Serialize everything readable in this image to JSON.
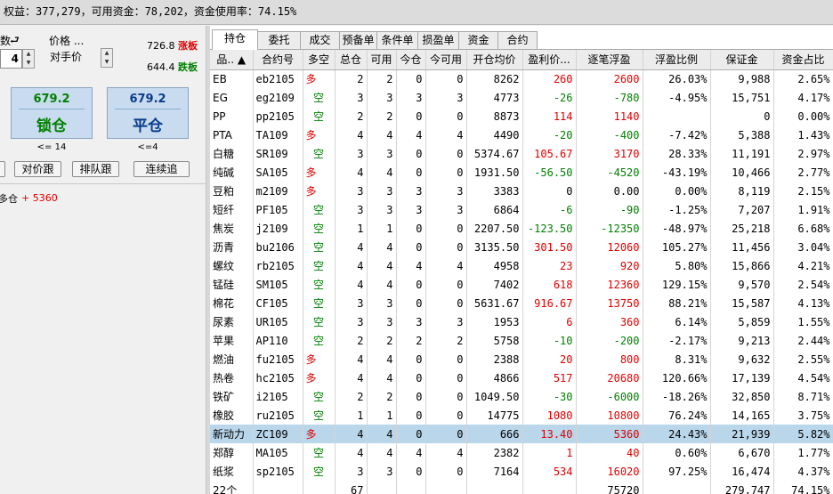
{
  "topbar": {
    "text": "权益：377,279，可用资金：78,202，资金使用率：74.15%"
  },
  "left": {
    "qty_label": "数",
    "qty_value": "4",
    "price_label": "价格 ...",
    "price_value": "对手价",
    "upper_price": "726.8",
    "upper_tag": "涨板",
    "lower_price": "644.4",
    "lower_tag": "跌板",
    "lock_btn": {
      "price": "679.2",
      "label": "锁仓"
    },
    "close_btn": {
      "price": "679.2",
      "label": "平仓"
    },
    "lock_note": "<= 14",
    "close_note": "<=4",
    "actions": [
      "对价跟",
      "排队跟",
      "连续追"
    ],
    "status_prefix": "多仓",
    "status_value": "+ 5360"
  },
  "tabs": [
    "持仓",
    "委托",
    "成交",
    "预备单",
    "条件单",
    "损盈单",
    "资金",
    "合约"
  ],
  "columns": [
    "品.. ▲",
    "合约号",
    "多空",
    "总仓",
    "可用",
    "今仓",
    "今可用",
    "开仓均价",
    "盈利价...",
    "逐笔浮盈",
    "浮盈比例",
    "保证金",
    "资金占比"
  ],
  "rows": [
    [
      "EB",
      "eb2105",
      "多",
      "2",
      "2",
      "0",
      "0",
      "8262",
      "260",
      "2600",
      "26.03%",
      "9,988",
      "2.65%"
    ],
    [
      "EG",
      "eg2109",
      "空",
      "3",
      "3",
      "3",
      "3",
      "4773",
      "-26",
      "-780",
      "-4.95%",
      "15,751",
      "4.17%"
    ],
    [
      "PP",
      "pp2105",
      "空",
      "2",
      "2",
      "0",
      "0",
      "8873",
      "114",
      "1140",
      "",
      "0",
      "0.00%"
    ],
    [
      "PTA",
      "TA109",
      "多",
      "4",
      "4",
      "4",
      "4",
      "4490",
      "-20",
      "-400",
      "-7.42%",
      "5,388",
      "1.43%"
    ],
    [
      "白糖",
      "SR109",
      "空",
      "3",
      "3",
      "0",
      "0",
      "5374.67",
      "105.67",
      "3170",
      "28.33%",
      "11,191",
      "2.97%"
    ],
    [
      "纯碱",
      "SA105",
      "多",
      "4",
      "4",
      "0",
      "0",
      "1931.50",
      "-56.50",
      "-4520",
      "-43.19%",
      "10,466",
      "2.77%"
    ],
    [
      "豆粕",
      "m2109",
      "多",
      "3",
      "3",
      "3",
      "3",
      "3383",
      "0",
      "0.00",
      "0.00%",
      "8,119",
      "2.15%"
    ],
    [
      "短纤",
      "PF105",
      "空",
      "3",
      "3",
      "3",
      "3",
      "6864",
      "-6",
      "-90",
      "-1.25%",
      "7,207",
      "1.91%"
    ],
    [
      "焦炭",
      "j2109",
      "空",
      "1",
      "1",
      "0",
      "0",
      "2207.50",
      "-123.50",
      "-12350",
      "-48.97%",
      "25,218",
      "6.68%"
    ],
    [
      "沥青",
      "bu2106",
      "空",
      "4",
      "4",
      "0",
      "0",
      "3135.50",
      "301.50",
      "12060",
      "105.27%",
      "11,456",
      "3.04%"
    ],
    [
      "螺纹",
      "rb2105",
      "空",
      "4",
      "4",
      "4",
      "4",
      "4958",
      "23",
      "920",
      "5.80%",
      "15,866",
      "4.21%"
    ],
    [
      "锰硅",
      "SM105",
      "空",
      "4",
      "4",
      "0",
      "0",
      "7402",
      "618",
      "12360",
      "129.15%",
      "9,570",
      "2.54%"
    ],
    [
      "棉花",
      "CF105",
      "空",
      "3",
      "3",
      "0",
      "0",
      "5631.67",
      "916.67",
      "13750",
      "88.21%",
      "15,587",
      "4.13%"
    ],
    [
      "尿素",
      "UR105",
      "空",
      "3",
      "3",
      "3",
      "3",
      "1953",
      "6",
      "360",
      "6.14%",
      "5,859",
      "1.55%"
    ],
    [
      "苹果",
      "AP110",
      "空",
      "2",
      "2",
      "2",
      "2",
      "5758",
      "-10",
      "-200",
      "-2.17%",
      "9,213",
      "2.44%"
    ],
    [
      "燃油",
      "fu2105",
      "多",
      "4",
      "4",
      "0",
      "0",
      "2388",
      "20",
      "800",
      "8.31%",
      "9,632",
      "2.55%"
    ],
    [
      "热卷",
      "hc2105",
      "多",
      "4",
      "4",
      "0",
      "0",
      "4866",
      "517",
      "20680",
      "120.66%",
      "17,139",
      "4.54%"
    ],
    [
      "铁矿",
      "i2105",
      "空",
      "2",
      "2",
      "0",
      "0",
      "1049.50",
      "-30",
      "-6000",
      "-18.26%",
      "32,850",
      "8.71%"
    ],
    [
      "橡胶",
      "ru2105",
      "空",
      "1",
      "1",
      "0",
      "0",
      "14775",
      "1080",
      "10800",
      "76.24%",
      "14,165",
      "3.75%"
    ],
    [
      "新动力",
      "ZC109",
      "多",
      "4",
      "4",
      "0",
      "0",
      "666",
      "13.40",
      "5360",
      "24.43%",
      "21,939",
      "5.82%"
    ],
    [
      "郑醇",
      "MA105",
      "空",
      "4",
      "4",
      "4",
      "4",
      "2382",
      "1",
      "40",
      "0.60%",
      "6,670",
      "1.77%"
    ],
    [
      "纸浆",
      "sp2105",
      "空",
      "3",
      "3",
      "0",
      "0",
      "7164",
      "534",
      "16020",
      "97.25%",
      "16,474",
      "4.37%"
    ]
  ],
  "selected_row": 19,
  "footer": [
    "22个",
    "",
    "",
    "67",
    "",
    "",
    "",
    "",
    "",
    "75720",
    "",
    "279,747",
    "74.15%"
  ],
  "colors": {
    "red": "#e00000",
    "green": "#008000",
    "selected": "#b9d6ea",
    "button": "#c9dcef"
  }
}
